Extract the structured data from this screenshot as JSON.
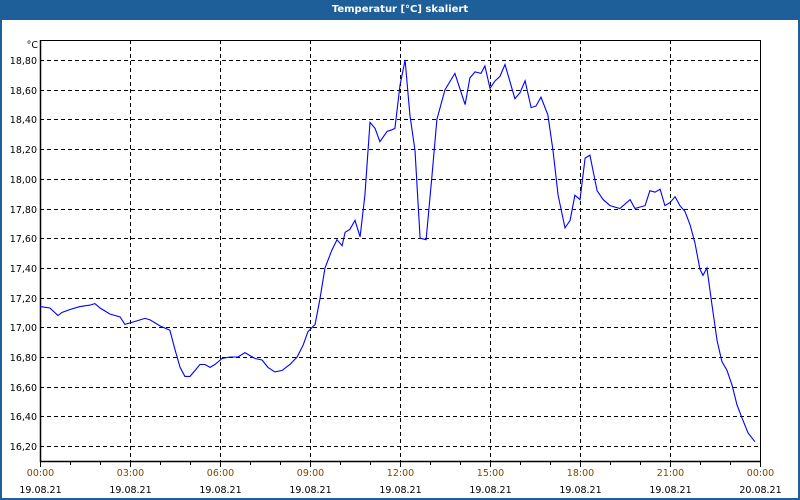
{
  "window": {
    "title": "Temperatur [°C] skaliert"
  },
  "colors": {
    "titlebar": "#1f5f99",
    "line": "#0000ff",
    "time_label": "#7a4a00",
    "grid": "#000000"
  },
  "chart_data": {
    "type": "line",
    "title": "Temperatur [°C] skaliert",
    "ylabel": "°C",
    "xlabel": "",
    "xlim_hours": [
      0,
      24
    ],
    "ylim": [
      16.1,
      18.935
    ],
    "grid": true,
    "y_ticks": [
      "16,20",
      "16,40",
      "16,60",
      "16,80",
      "17,00",
      "17,20",
      "17,40",
      "17,60",
      "17,80",
      "18,00",
      "18,20",
      "18,40",
      "18,60",
      "18,80"
    ],
    "y_tick_values": [
      16.2,
      16.4,
      16.6,
      16.8,
      17.0,
      17.2,
      17.4,
      17.6,
      17.8,
      18.0,
      18.2,
      18.4,
      18.6,
      18.8
    ],
    "x_ticks": [
      {
        "time": "00:00",
        "date": "19.08.21",
        "hour": 0
      },
      {
        "time": "03:00",
        "date": "19.08.21",
        "hour": 3
      },
      {
        "time": "06:00",
        "date": "19.08.21",
        "hour": 6
      },
      {
        "time": "09:00",
        "date": "19.08.21",
        "hour": 9
      },
      {
        "time": "12:00",
        "date": "19.08.21",
        "hour": 12
      },
      {
        "time": "15:00",
        "date": "19.08.21",
        "hour": 15
      },
      {
        "time": "18:00",
        "date": "19.08.21",
        "hour": 18
      },
      {
        "time": "21:00",
        "date": "19.08.21",
        "hour": 21
      },
      {
        "time": "00:00",
        "date": "20.08.21",
        "hour": 24
      }
    ],
    "series": [
      {
        "name": "Temperatur",
        "x_hours": [
          0,
          0.33,
          0.6,
          0.73,
          1,
          1.33,
          1.67,
          1.83,
          2,
          2.33,
          2.67,
          2.83,
          3.17,
          3.5,
          3.67,
          4,
          4.33,
          4.5,
          4.67,
          4.83,
          5,
          5.17,
          5.33,
          5.5,
          5.67,
          5.83,
          6.07,
          6.33,
          6.6,
          6.83,
          7,
          7.17,
          7.4,
          7.6,
          7.83,
          8.07,
          8.33,
          8.57,
          8.77,
          8.93,
          9.17,
          9.33,
          9.5,
          9.73,
          9.9,
          10.07,
          10.17,
          10.33,
          10.5,
          10.67,
          10.83,
          11,
          11.17,
          11.33,
          11.57,
          11.73,
          11.83,
          12,
          12.17,
          12.33,
          12.5,
          12.67,
          12.87,
          13.07,
          13.23,
          13.5,
          13.83,
          14.17,
          14.33,
          14.5,
          14.7,
          14.83,
          15,
          15.17,
          15.33,
          15.5,
          15.83,
          16,
          16.17,
          16.37,
          16.53,
          16.7,
          16.93,
          17.1,
          17.27,
          17.5,
          17.67,
          17.83,
          18,
          18.17,
          18.33,
          18.57,
          18.77,
          19,
          19.33,
          19.67,
          19.83,
          20.17,
          20.33,
          20.5,
          20.67,
          20.83,
          21,
          21.17,
          21.33,
          21.5,
          21.67,
          21.83,
          22,
          22.1,
          22.23,
          22.4,
          22.57,
          22.73,
          22.9,
          23.07,
          23.23,
          23.4,
          23.6,
          23.83
        ],
        "values": [
          17.14,
          17.13,
          17.08,
          17.1,
          17.12,
          17.14,
          17.15,
          17.16,
          17.13,
          17.09,
          17.07,
          17.02,
          17.04,
          17.06,
          17.05,
          17.01,
          16.98,
          16.85,
          16.73,
          16.67,
          16.67,
          16.71,
          16.75,
          16.75,
          16.73,
          16.75,
          16.79,
          16.8,
          16.8,
          16.83,
          16.81,
          16.79,
          16.78,
          16.73,
          16.7,
          16.71,
          16.75,
          16.8,
          16.88,
          16.97,
          17.02,
          17.19,
          17.4,
          17.52,
          17.59,
          17.55,
          17.64,
          17.66,
          17.72,
          17.61,
          17.89,
          18.38,
          18.34,
          18.25,
          18.32,
          18.33,
          18.34,
          18.63,
          18.8,
          18.43,
          18.19,
          17.6,
          17.59,
          18.03,
          18.4,
          18.6,
          18.71,
          18.5,
          18.68,
          18.72,
          18.71,
          18.76,
          18.61,
          18.66,
          18.69,
          18.77,
          18.54,
          18.58,
          18.66,
          18.48,
          18.49,
          18.55,
          18.43,
          18.19,
          17.89,
          17.67,
          17.72,
          17.89,
          17.86,
          18.14,
          18.16,
          17.92,
          17.86,
          17.82,
          17.8,
          17.86,
          17.8,
          17.82,
          17.92,
          17.91,
          17.93,
          17.82,
          17.84,
          17.88,
          17.82,
          17.78,
          17.69,
          17.57,
          17.39,
          17.35,
          17.4,
          17.15,
          16.91,
          16.77,
          16.71,
          16.61,
          16.48,
          16.39,
          16.29,
          16.23
        ]
      }
    ]
  }
}
